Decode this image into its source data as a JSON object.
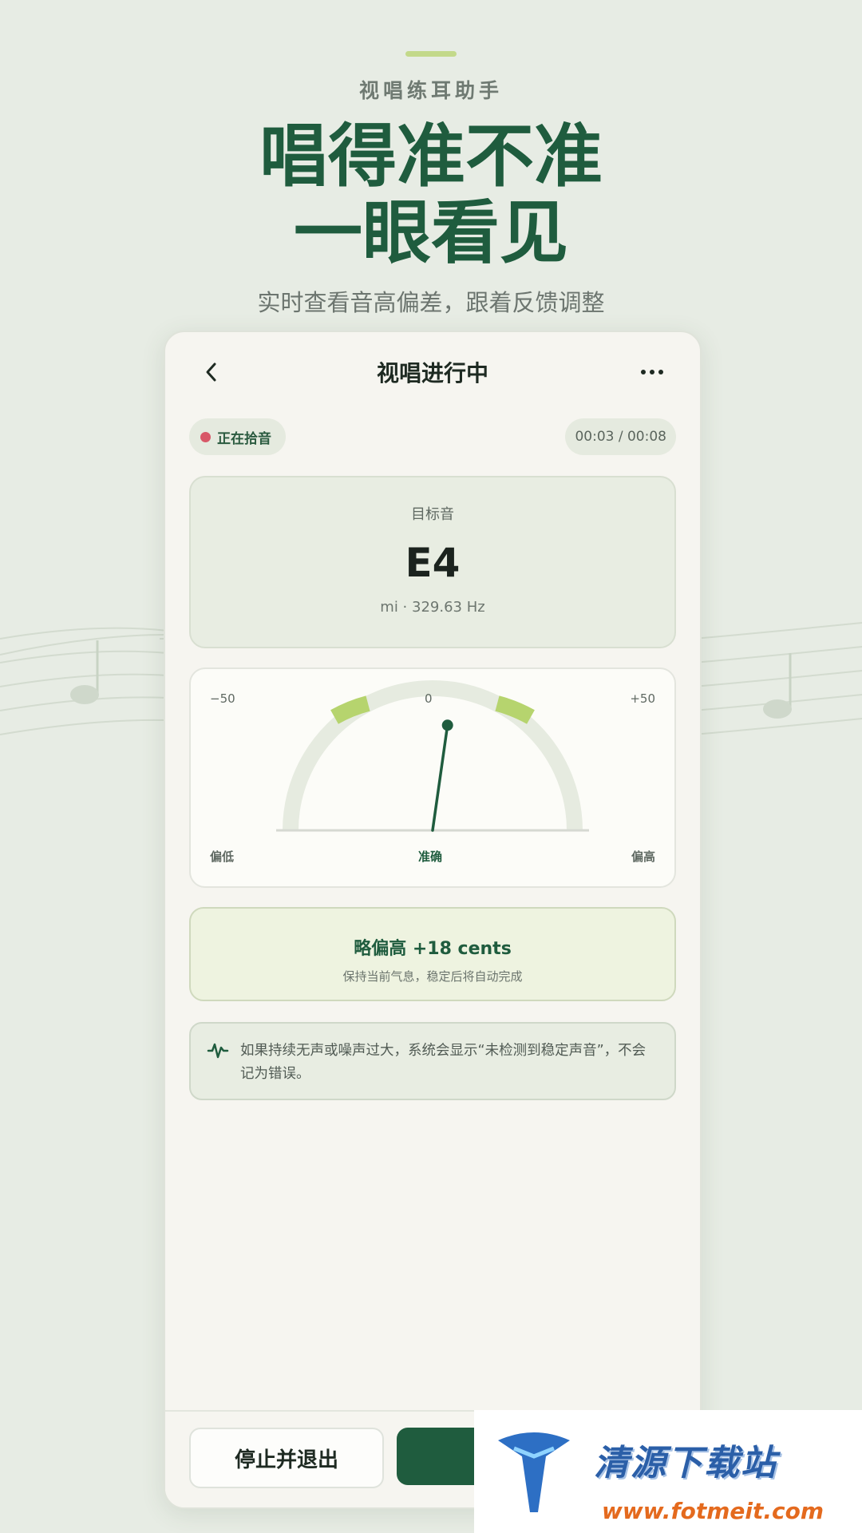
{
  "promo": {
    "kicker": "视唱练耳助手",
    "title_line1": "唱得准不准",
    "title_line2": "一眼看见",
    "subtitle": "实时查看音高偏差，跟着反馈调整"
  },
  "nav": {
    "back_icon": "chevron-left-icon",
    "title": "视唱进行中",
    "more_icon": "more-horizontal-icon"
  },
  "status": {
    "recording_label": "正在拾音",
    "recording_color": "#d85868",
    "time": "00:03 / 00:08"
  },
  "target": {
    "label": "目标音",
    "note": "E4",
    "detail": "mi · 329.63 Hz"
  },
  "meter": {
    "min_label": "−50",
    "center_label": "0",
    "max_label": "+50",
    "left_caption": "偏低",
    "center_caption": "准确",
    "right_caption": "偏高",
    "deviation_cents": 18,
    "range_cents": 50
  },
  "feedback": {
    "title": "略偏高 +18 cents",
    "subtitle": "保持当前气息，稳定后将自动完成"
  },
  "info": {
    "icon": "waveform-icon",
    "text": "如果持续无声或噪声过大，系统会显示“未检测到稳定声音”，不会记为错误。"
  },
  "actions": {
    "stop_label": "停止并退出",
    "primary_color": "#1f5c3e"
  },
  "watermark": {
    "text": "清源下载站",
    "url": "www.fotmeit.com"
  },
  "colors": {
    "accent_green": "#1f5c3e",
    "light_green": "#b6d46e",
    "background": "#e7ece4"
  }
}
